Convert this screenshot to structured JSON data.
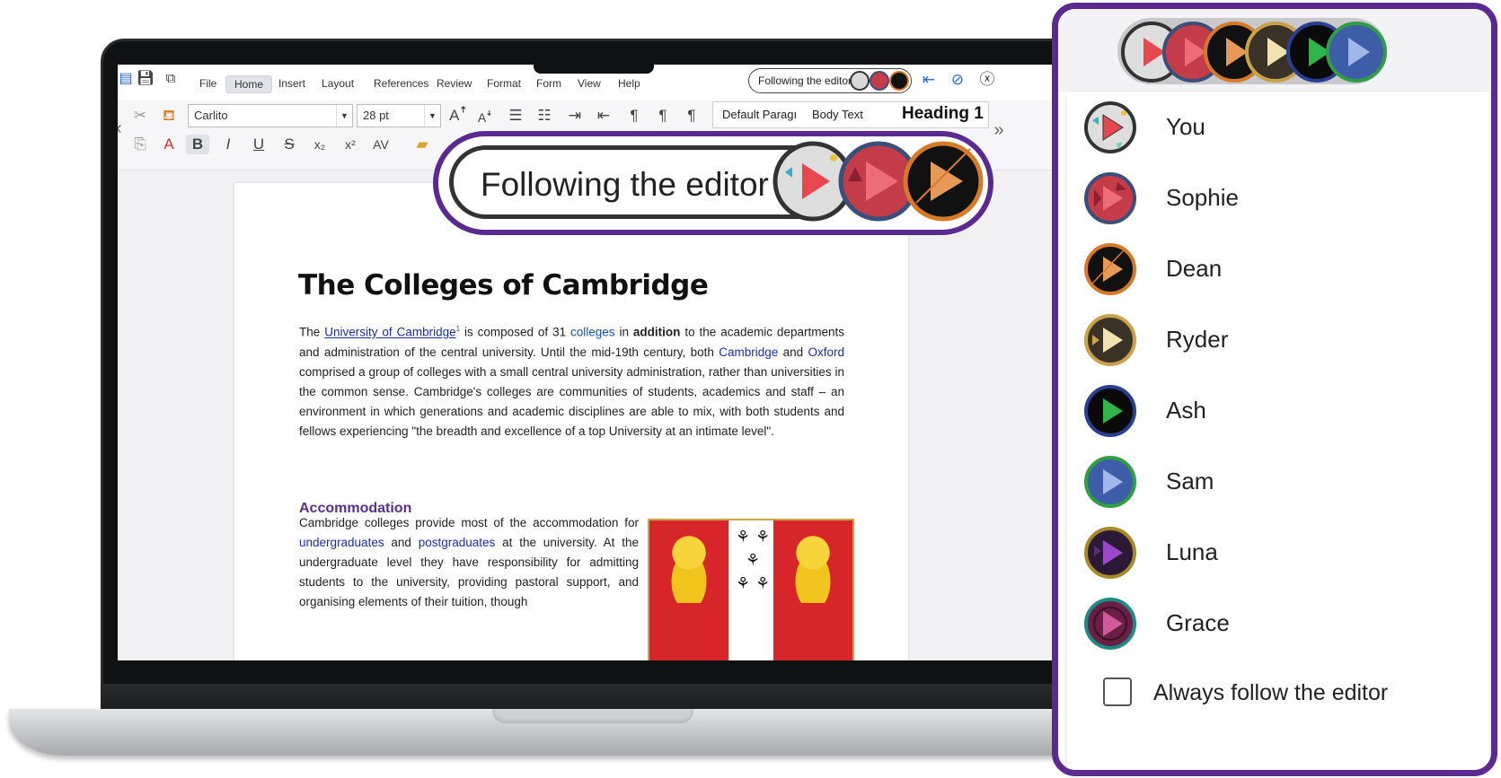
{
  "app": {
    "menu": [
      "File",
      "Home",
      "Insert",
      "Layout",
      "References",
      "Review",
      "Format",
      "Form",
      "View",
      "Help"
    ],
    "active_menu": "Home",
    "font_name": "Carlito",
    "font_size": "28 pt",
    "styles": [
      "Default Paragı",
      "Body Text",
      "Heading 1"
    ],
    "follow_chip": "Following the editor",
    "collapse_left": "«",
    "collapse_right": "»"
  },
  "document": {
    "title": "The Colleges of Cambridge",
    "para1": {
      "t1": "The ",
      "link1": "University of Cambridge",
      "sup": "1",
      "t2": " is composed of 31 ",
      "link2": "colleges",
      "t3": " in ",
      "bold": "addition",
      "t4": " to the academic departments and administration of the central university. Until the mid-19th century, both ",
      "link3": "Cambridge",
      "t5": " and ",
      "link4": "Oxford",
      "t6": " comprised a group of colleges with a small central university administration, rather than universities in the common sense. Cambridge's colleges are communities of students, academics and staff – an environment in which generations and academic disciplines are able to mix, with both students and fellows experiencing \"the breadth and excellence of a top University at an intimate level\"."
    },
    "heading2": "Accommodation",
    "para2": {
      "t1": "Cambridge colleges provide most of the accommodation for ",
      "link1": "undergraduates",
      "t2": " and ",
      "link2": "postgraduates",
      "t3": " at the university. At the undergraduate level they have responsibility for admitting students to the university, providing pastoral support, and organising elements of their tuition, though"
    }
  },
  "callout": {
    "label": "Following the editor"
  },
  "panel": {
    "users": [
      {
        "name": "You",
        "colors": {
          "bg": "#d9d9d9",
          "ring": "#333333",
          "tri": "#e8474f"
        }
      },
      {
        "name": "Sophie",
        "colors": {
          "bg": "#c43c49",
          "ring": "#3a4f7a",
          "tri": "#f07a82"
        }
      },
      {
        "name": "Dean",
        "colors": {
          "bg": "#111111",
          "ring": "#d77a27",
          "tri": "#e79a57"
        }
      },
      {
        "name": "Ryder",
        "colors": {
          "bg": "#3a3226",
          "ring": "#c9a24b",
          "tri": "#f1e2b0"
        }
      },
      {
        "name": "Ash",
        "colors": {
          "bg": "#0a0a0a",
          "ring": "#2a3f8f",
          "tri": "#2fb54a"
        }
      },
      {
        "name": "Sam",
        "colors": {
          "bg": "#3e5da8",
          "ring": "#2f9e44",
          "tri": "#9fb7ea"
        }
      },
      {
        "name": "Luna",
        "colors": {
          "bg": "#2a1a35",
          "ring": "#a88a2a",
          "tri": "#9a48c9"
        }
      },
      {
        "name": "Grace",
        "colors": {
          "bg": "#6a1f45",
          "ring": "#1f8a83",
          "tri": "#d05a9a"
        }
      }
    ],
    "always_follow": "Always follow the editor",
    "always_follow_checked": false
  },
  "accent": "#5b2a90"
}
